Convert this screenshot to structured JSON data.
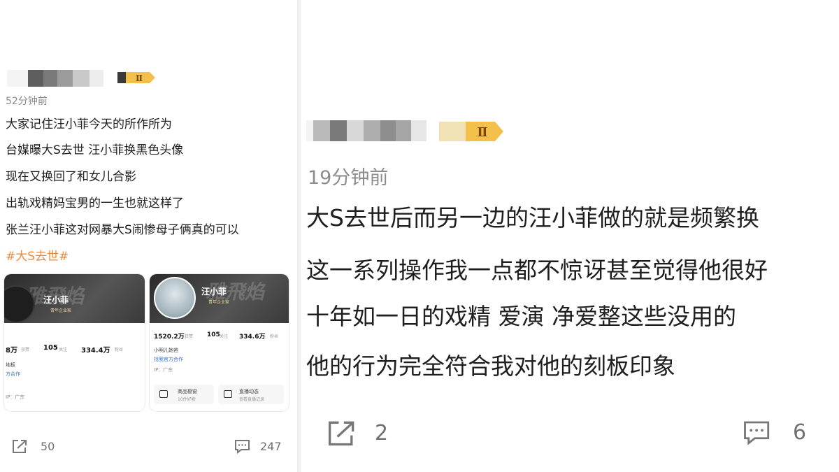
{
  "left_post": {
    "time": "52分钟前",
    "vip_label": "Ⅱ",
    "lines": [
      "大家记住汪小菲今天的所作所为",
      "台媒曝大S去世 汪小菲换黑色头像",
      "现在又换回了和女儿合影",
      "出轨戏精妈宝男的一生也就这样了",
      "张兰汪小菲这对网暴大S闹惨母子俩真的可以"
    ],
    "hashtag": "#大S去世#",
    "card1": {
      "name": "汪小菲",
      "badge": "青年企业家",
      "stats": [
        {
          "value": "8万",
          "label": "获赞"
        },
        {
          "value": "105",
          "label": "关注"
        },
        {
          "value": "334.4万",
          "label": "粉丝"
        }
      ],
      "info": [
        "地板",
        "方合作",
        "IP：广东"
      ]
    },
    "card2": {
      "name": "汪小菲",
      "badge": "青年企业家",
      "stats": [
        {
          "value": "1520.2万",
          "label": "获赞"
        },
        {
          "value": "105",
          "label": "关注"
        },
        {
          "value": "334.6万",
          "label": "粉丝"
        }
      ],
      "info": [
        "小明儿她爸",
        "找我官方合作",
        "IP：广东"
      ],
      "buttons": [
        {
          "label": "商品橱窗",
          "sub": "10件好物"
        },
        {
          "label": "直播动态",
          "sub": "查看直播记录"
        }
      ]
    },
    "repost_count": "50",
    "comment_count": "247"
  },
  "right_post": {
    "time": "19分钟前",
    "vip_label": "Ⅱ",
    "lines": [
      "大S去世后而另一边的汪小菲做的就是频繁换",
      "这一系列操作我一点都不惊讶甚至觉得他很好",
      "十年如一日的戏精 爱演 净爱整这些没用的",
      "他的行为完全符合我对他的刻板印象"
    ],
    "repost_count": "2",
    "comment_count": "6"
  },
  "icons": {
    "repost": "repost-icon",
    "comment": "comment-icon",
    "vip": "vip-badge-icon"
  },
  "colors": {
    "hashtag": "#ef8a3c",
    "time": "#8c8c8c",
    "vip": "#f3c14b"
  }
}
